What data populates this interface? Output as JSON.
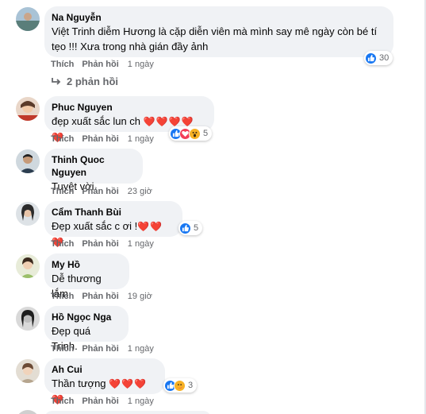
{
  "comments": [
    {
      "author": "Na Nguyễn",
      "text": "Việt Trinh diễm Hương là cặp diễn viên mà mình say mê ngày còn bé tí\ntẹo !!! Xưa trong nhà gián đầy ảnh",
      "like": "Thích",
      "reply": "Phản hồi",
      "time": "1 ngày",
      "reaction_count": "30",
      "reactions": [
        "like-icon"
      ]
    },
    {
      "author": "Phuc Nguyen",
      "text": "đẹp xuất sắc lun ch",
      "hearts": "❤️❤️❤️❤️❤️",
      "like": "Thích",
      "reply": "Phản hồi",
      "time": "1 ngày",
      "reaction_count": "5",
      "reactions": [
        "like-icon",
        "love-icon",
        "wow-icon"
      ]
    },
    {
      "author": "Thinh Quoc Nguyen",
      "text": "Tuyệt vời.",
      "like": "Thích",
      "reply": "Phản hồi",
      "time": "23 giờ"
    },
    {
      "author": "Cẩm Thanh Bùi",
      "text": "Đẹp xuất sắc c ơi !",
      "hearts": "❤️❤️❤️",
      "like": "Thích",
      "reply": "Phản hồi",
      "time": "1 ngày",
      "reaction_count": "5",
      "reactions": [
        "like-icon"
      ]
    },
    {
      "author": "My Hồ",
      "text": "Dễ thương lắm",
      "like": "Thích",
      "reply": "Phản hồi",
      "time": "19 giờ"
    },
    {
      "author": "Hồ Ngọc Nga",
      "text": "Đẹp quá Trinh.",
      "like": "Thích",
      "reply": "Phản hồi",
      "time": "1 ngày"
    },
    {
      "author": "Ah Cui",
      "text": "Thần tượng",
      "hearts": "❤️❤️❤️❤️",
      "like": "Thích",
      "reply": "Phản hồi",
      "time": "1 ngày",
      "reaction_count": "3",
      "reactions": [
        "like-icon",
        "care-icon"
      ]
    }
  ],
  "replies_link": "2 phản hồi",
  "colors": {
    "bubble": "#f0f2f5",
    "like_blue": "#1877f2",
    "love_red": "#f33e58",
    "secondary_text": "#65676b"
  }
}
